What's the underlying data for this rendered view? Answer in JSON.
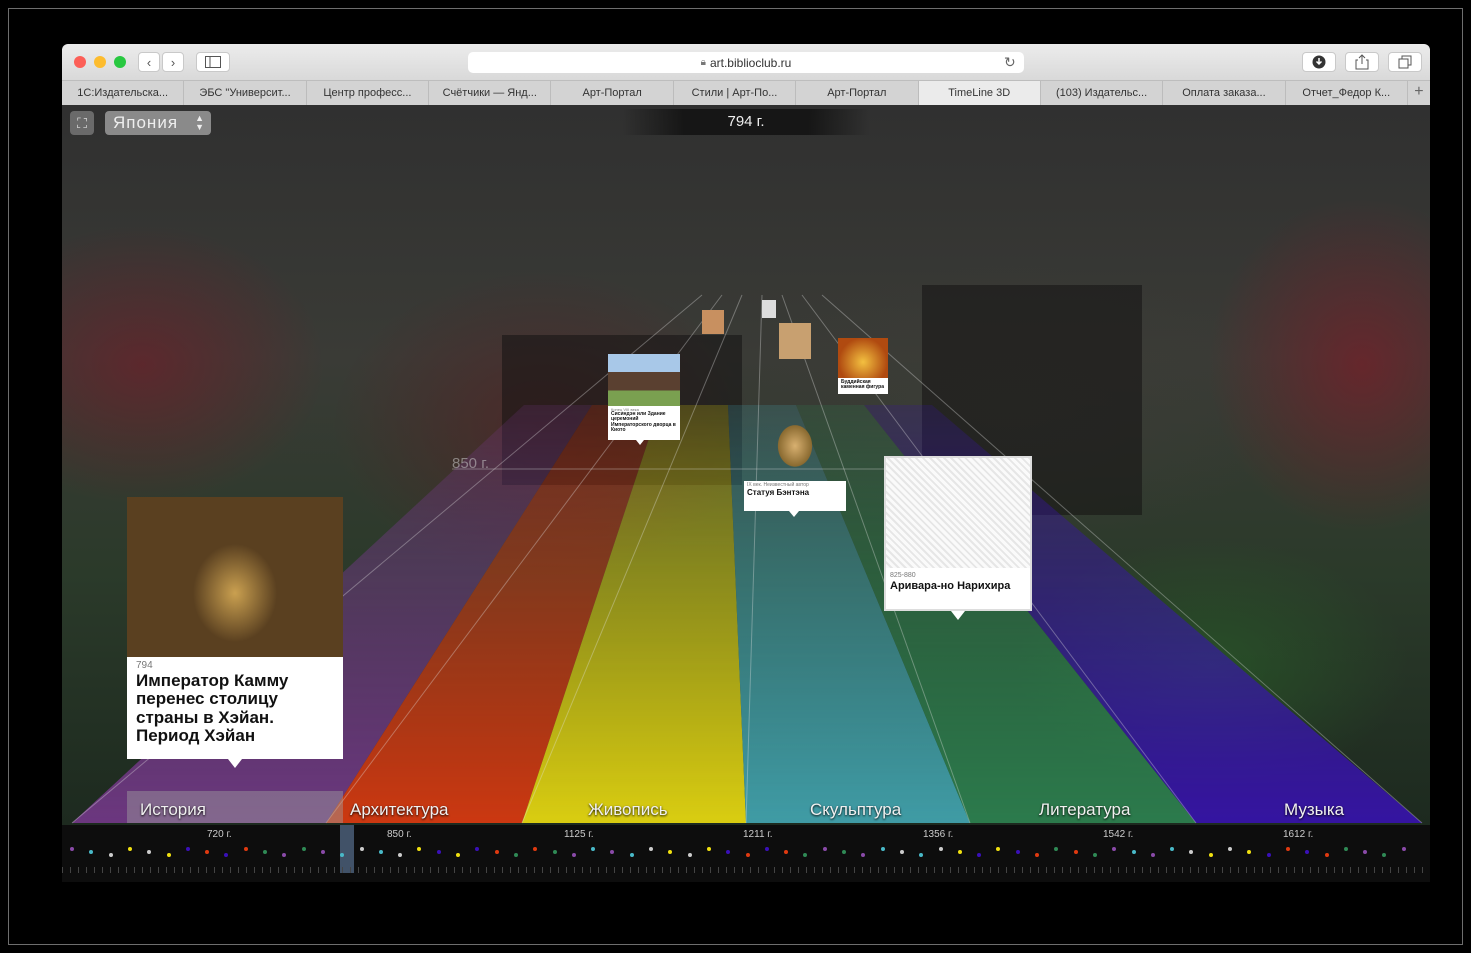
{
  "browser": {
    "address": "art.biblioclub.ru",
    "tabs": [
      {
        "label": "1С:Издательска..."
      },
      {
        "label": "ЭБС \"Университ..."
      },
      {
        "label": "Центр професс..."
      },
      {
        "label": "Счётчики — Янд..."
      },
      {
        "label": "Арт-Портал"
      },
      {
        "label": "Стили | Арт-По..."
      },
      {
        "label": "Арт-Портал"
      },
      {
        "label": "TimeLine 3D"
      },
      {
        "label": "(103) Издательс..."
      },
      {
        "label": "Оплата заказа..."
      },
      {
        "label": "Отчет_Федор К..."
      }
    ],
    "active_tab": "TimeLine 3D"
  },
  "app": {
    "country": "Япония",
    "current_year": "794 г.",
    "far_year": "850 г.",
    "categories": [
      {
        "label": "История",
        "color": "#7a3a90"
      },
      {
        "label": "Архитектура",
        "color": "#e03a10"
      },
      {
        "label": "Живопись",
        "color": "#f0e010"
      },
      {
        "label": "Скульптура",
        "color": "#49b9c8"
      },
      {
        "label": "Литература",
        "color": "#2f8a55"
      },
      {
        "label": "Музыка",
        "color": "#3a10b8"
      }
    ],
    "cards": {
      "main": {
        "date": "794",
        "title": "Император Камму перенес столицу страны в Хэйан. Период Хэйан"
      },
      "architecture": {
        "date": "Конец VIII века",
        "title": "Сисиндэн или Здание церемоний Императорского дворца в Киото"
      },
      "sculpture": {
        "date": "IX век. Неизвестный автор",
        "title": "Статуя Бэнтэна"
      },
      "literature": {
        "date": "825-880",
        "title": "Аривара-но Нарихира"
      },
      "far1": {
        "title": "Буддийская каменная фигура"
      }
    }
  },
  "timeline": {
    "years": [
      {
        "label": "720 г."
      },
      {
        "label": "850 г."
      },
      {
        "label": "1125 г."
      },
      {
        "label": "1211 г."
      },
      {
        "label": "1356 г."
      },
      {
        "label": "1542 г."
      },
      {
        "label": "1612 г."
      }
    ]
  }
}
